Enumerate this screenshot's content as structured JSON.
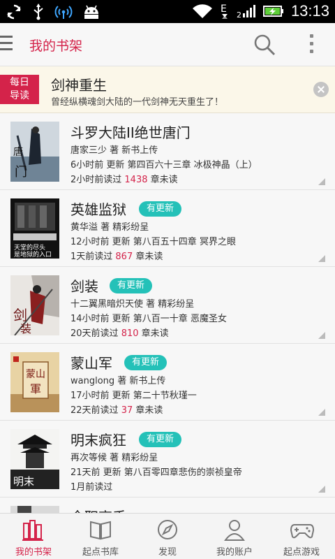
{
  "statusbar": {
    "time": "13:13",
    "icons": [
      "sync-icon",
      "usb-icon",
      "wifi-hotspot-icon",
      "android-icon",
      "wifi-icon",
      "data-e-icon",
      "signal-icon",
      "battery-charging-icon"
    ]
  },
  "appbar": {
    "title": "我的书架",
    "icons": [
      "menu-icon",
      "search-icon",
      "more-icon"
    ]
  },
  "banner": {
    "badge_line1": "每日",
    "badge_line2": "导读",
    "title": "剑神重生",
    "desc": "曾经纵横魂剑大陆的一代剑神无天重生了！"
  },
  "books": [
    {
      "title": "斗罗大陆II绝世唐门",
      "badge": "",
      "author_line": "唐家三少 著  新书上传",
      "update_line": "6小时前  更新  第四百六十三章 冰极神晶（上）",
      "read_prefix": "2小时前读过  ",
      "unread": "1438",
      "read_suffix": " 章未读"
    },
    {
      "title": "英雄监狱",
      "badge": "有更新",
      "author_line": "黄华溢 著  精彩纷呈",
      "update_line": "12小时前  更新  第八百五十四章 冥界之眼",
      "read_prefix": "1天前读过  ",
      "unread": "867",
      "read_suffix": " 章未读",
      "cover_text": [
        "天堂的尽头",
        "是地狱的入口"
      ]
    },
    {
      "title": "剑装",
      "badge": "有更新",
      "author_line": "十二翼黑暗炽天使 著  精彩纷呈",
      "update_line": "14小时前  更新  第八百一十章 恶魔圣女",
      "read_prefix": "20天前读过  ",
      "unread": "810",
      "read_suffix": " 章未读"
    },
    {
      "title": "蒙山军",
      "badge": "有更新",
      "author_line": "wanglong 著  新书上传",
      "update_line": "17小时前  更新  第二十节秋瑾一",
      "read_prefix": "22天前读过  ",
      "unread": "37",
      "read_suffix": " 章未读"
    },
    {
      "title": "明末疯狂",
      "badge": "有更新",
      "author_line": "再次等候 著  精彩纷呈",
      "update_line": "21天前  更新  第八百零四章悲伤的崇祯皇帝",
      "read_prefix": "1月前读过",
      "unread": "",
      "read_suffix": ""
    }
  ],
  "peek_book": {
    "title": "全职高手"
  },
  "nav": [
    {
      "label": "我的书架",
      "icon": "bookshelf-icon",
      "active": true
    },
    {
      "label": "起点书库",
      "icon": "open-book-icon",
      "active": false
    },
    {
      "label": "发现",
      "icon": "compass-icon",
      "active": false
    },
    {
      "label": "我的账户",
      "icon": "person-icon",
      "active": false
    },
    {
      "label": "起点游戏",
      "icon": "gamepad-icon",
      "active": false
    }
  ],
  "colors": {
    "accent": "#d4234a",
    "badge": "#24c1b8",
    "statusbar": "#000000"
  }
}
